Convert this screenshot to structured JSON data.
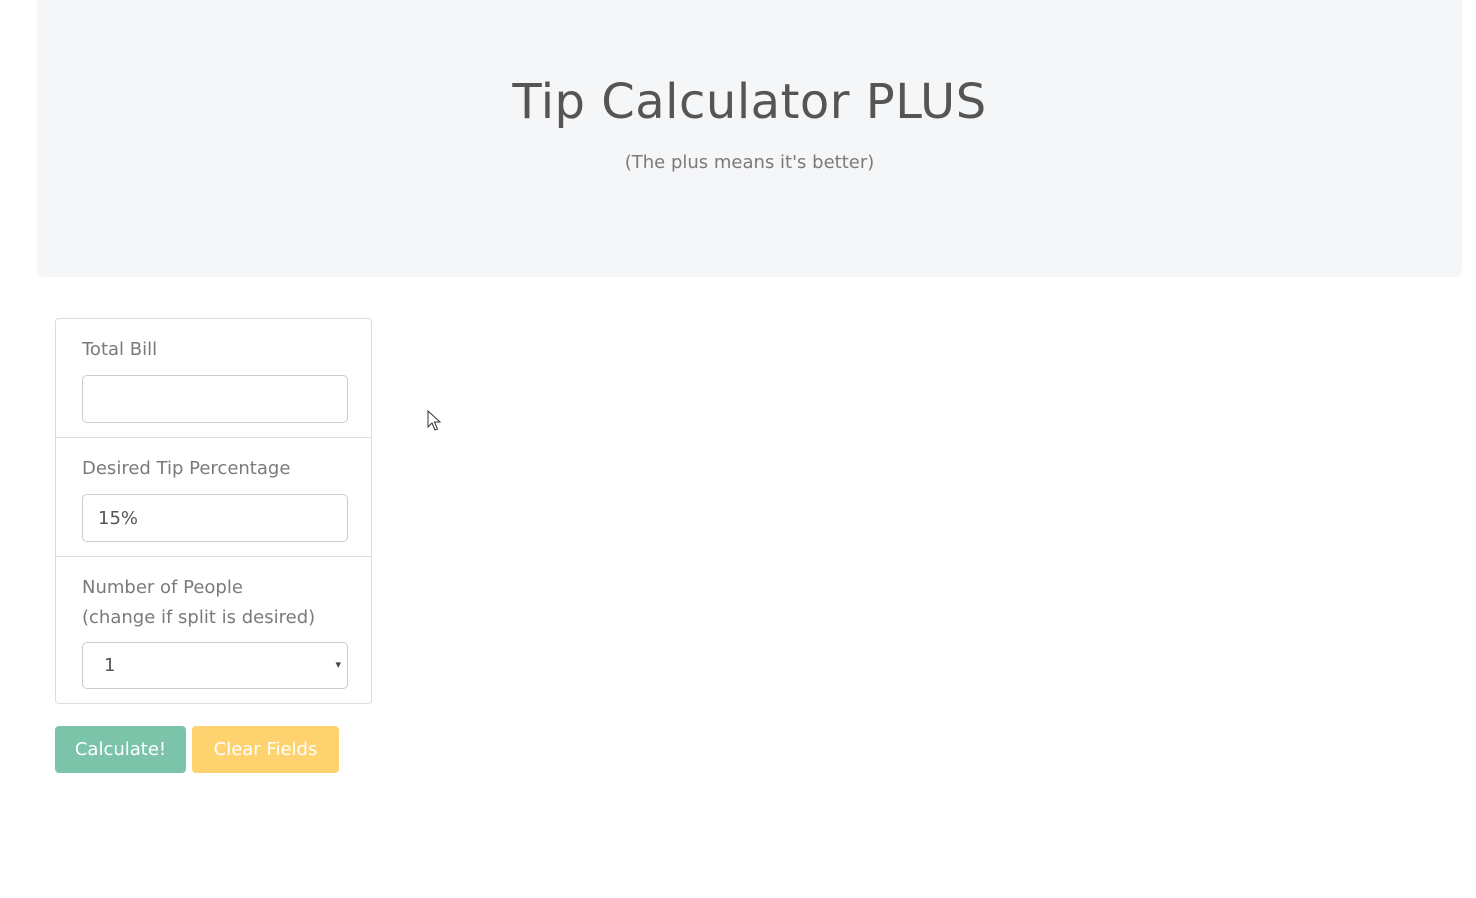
{
  "header": {
    "title": "Tip Calculator PLUS",
    "subtitle": "(The plus means it's better)"
  },
  "form": {
    "total_bill": {
      "label": "Total Bill",
      "value": ""
    },
    "tip_percentage": {
      "label": "Desired Tip Percentage",
      "value": "15%"
    },
    "people": {
      "label_line1": "Number of People",
      "label_line2": "(change if split is desired)",
      "selected": "1",
      "icon": "chevron-down-icon"
    }
  },
  "actions": {
    "calculate_label": "Calculate!",
    "clear_label": "Clear Fields"
  },
  "colors": {
    "calculate": "#7cc4a9",
    "clear": "#fdd26f",
    "header_bg": "#f5f6f8"
  }
}
